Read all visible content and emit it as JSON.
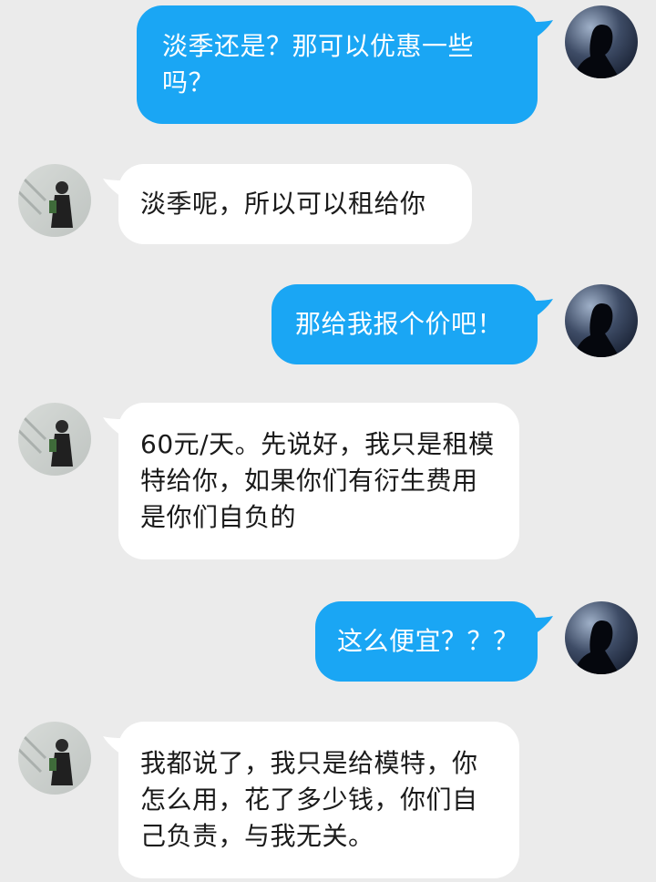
{
  "conversation": {
    "messages": [
      {
        "sender": "me",
        "text": "淡季还是？那可以优惠一些吗？"
      },
      {
        "sender": "other",
        "text": "淡季呢，所以可以租给你"
      },
      {
        "sender": "me",
        "text": "那给我报个价吧！"
      },
      {
        "sender": "other",
        "text": "60元/天。先说好，我只是租模特给你，如果你们有衍生费用是你们自负的"
      },
      {
        "sender": "me",
        "text": "这么便宜？？？"
      },
      {
        "sender": "other",
        "text": "我都说了，我只是给模特，你怎么用，花了多少钱，你们自己负责，与我无关。"
      }
    ]
  },
  "colors": {
    "background": "#ebebeb",
    "outgoing_bubble": "#1aa6f4",
    "incoming_bubble": "#ffffff",
    "outgoing_text": "#ffffff",
    "incoming_text": "#1a1a1a"
  },
  "avatars": {
    "me": "dark-silhouette-avatar",
    "other": "girl-photo-avatar"
  }
}
